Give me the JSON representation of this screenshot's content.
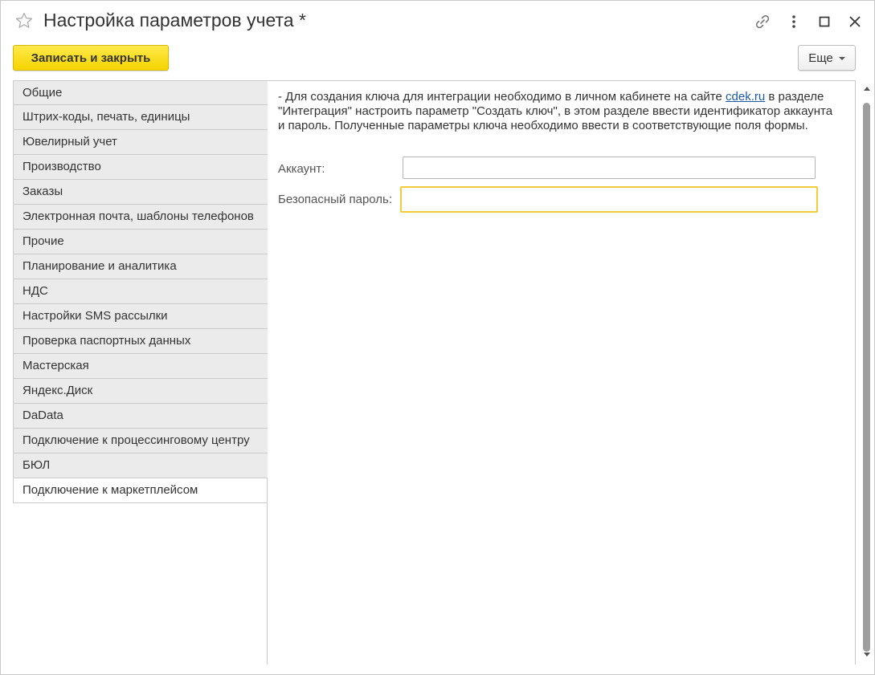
{
  "window": {
    "title": "Настройка параметров учета *"
  },
  "header_icons": [
    "star-icon",
    "link-icon",
    "more-vertical-icon",
    "maximize-icon",
    "close-icon"
  ],
  "toolbar": {
    "save_label": "Записать и закрыть",
    "more_label": "Еще"
  },
  "tabs": [
    {
      "label": "Общие"
    },
    {
      "label": "Штрих-коды, печать, единицы"
    },
    {
      "label": "Ювелирный учет"
    },
    {
      "label": "Производство"
    },
    {
      "label": "Заказы"
    },
    {
      "label": "Электронная почта, шаблоны телефонов"
    },
    {
      "label": "Прочие"
    },
    {
      "label": "Планирование и аналитика"
    },
    {
      "label": "НДС"
    },
    {
      "label": "Настройки SMS рассылки"
    },
    {
      "label": "Проверка паспортных данных"
    },
    {
      "label": "Мастерская"
    },
    {
      "label": "Яндекс.Диск"
    },
    {
      "label": "DaData"
    },
    {
      "label": "Подключение к процессинговому центру"
    },
    {
      "label": "БЮЛ"
    },
    {
      "label": "Подключение к маркетплейсом",
      "active": true
    }
  ],
  "content": {
    "info_before_link": "- Для  создания ключа для интеграции необходимо  в личном кабинете на сайте ",
    "info_link": "cdek.ru",
    "info_after_link": " в разделе \"Интеграция\" настроить параметр \"Создать ключ\", в этом разделе ввести идентификатор аккаунта и пароль. Полученные параметры ключа необходимо ввести в соответствующие поля формы.",
    "account_label": "Аккаунт:",
    "account_value": "",
    "password_label": "Безопасный пароль:",
    "password_value": ""
  },
  "colors": {
    "accent_button": "#f5d400",
    "active_field_border": "#f1cd3a",
    "link": "#1a5aa8",
    "tab_bg": "#ebebeb"
  }
}
